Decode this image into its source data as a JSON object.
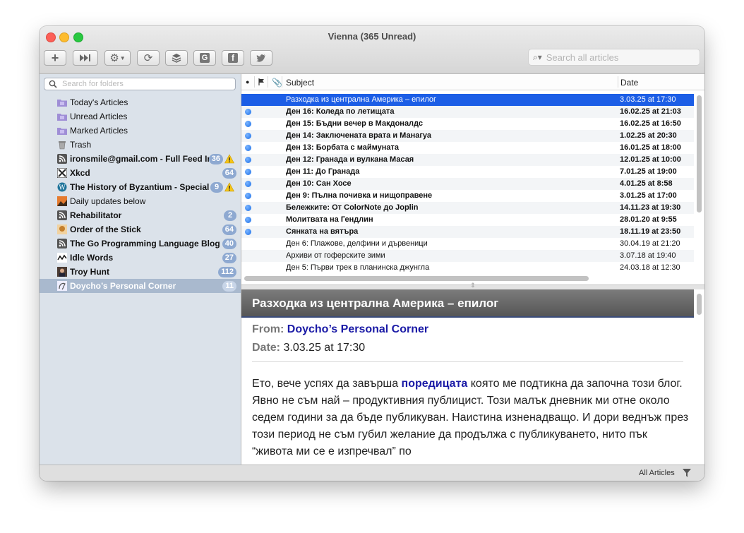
{
  "window": {
    "title": "Vienna (365 Unread)"
  },
  "toolbar": {
    "buttons": [
      {
        "name": "add-subscription",
        "glyph": "+"
      },
      {
        "name": "skip-unread",
        "glyph": "⏭"
      },
      {
        "name": "action-menu",
        "glyph": "⚙▾"
      },
      {
        "name": "refresh",
        "glyph": "⟳"
      },
      {
        "name": "layers",
        "glyph": "≋"
      },
      {
        "name": "google",
        "glyph": "G"
      },
      {
        "name": "facebook",
        "glyph": "f"
      },
      {
        "name": "twitter",
        "glyph": "🐦"
      }
    ],
    "search_placeholder": "Search all articles"
  },
  "sidebar": {
    "search_placeholder": "Search for folders",
    "items": [
      {
        "label": "Today's Articles",
        "icon": "smart-folder",
        "bold": false,
        "count": ""
      },
      {
        "label": "Unread Articles",
        "icon": "smart-folder",
        "bold": false,
        "count": ""
      },
      {
        "label": "Marked Articles",
        "icon": "smart-folder",
        "bold": false,
        "count": ""
      },
      {
        "label": "Trash",
        "icon": "trash",
        "bold": false,
        "count": ""
      },
      {
        "label": "ironsmile@gmail.com - Full Feed In",
        "icon": "rss",
        "bold": true,
        "count": "36",
        "warning": true
      },
      {
        "label": "Xkcd",
        "icon": "xkcd",
        "bold": true,
        "count": "64"
      },
      {
        "label": "The History of Byzantium - Special",
        "icon": "wordpress",
        "bold": true,
        "count": "9",
        "warning": true
      },
      {
        "label": "Daily updates below",
        "icon": "landscape",
        "bold": false,
        "count": ""
      },
      {
        "label": "Rehabilitator",
        "icon": "rss",
        "bold": true,
        "count": "2"
      },
      {
        "label": "Order of the Stick",
        "icon": "oots",
        "bold": true,
        "count": "64"
      },
      {
        "label": "The Go Programming Language Blog",
        "icon": "rss",
        "bold": true,
        "count": "40"
      },
      {
        "label": "Idle Words",
        "icon": "idle",
        "bold": true,
        "count": "27"
      },
      {
        "label": "Troy Hunt",
        "icon": "troy",
        "bold": true,
        "count": "112"
      },
      {
        "label": "Doycho’s Personal Corner",
        "icon": "doycho",
        "bold": true,
        "count": "11",
        "selected": true
      }
    ]
  },
  "list": {
    "columns": {
      "subject": "Subject",
      "date": "Date"
    },
    "rows": [
      {
        "subject": "Разходка из централна Америка – епилог",
        "date": "3.03.25 at 17:30",
        "unread": false,
        "selected": true
      },
      {
        "subject": "Ден 16: Коледа по летищата",
        "date": "16.02.25 at 21:03",
        "unread": true
      },
      {
        "subject": "Ден 15: Бъдни вечер в Макдоналдс",
        "date": "16.02.25 at 16:50",
        "unread": true
      },
      {
        "subject": "Ден 14: Заключената врата и Манагуа",
        "date": "1.02.25 at 20:30",
        "unread": true
      },
      {
        "subject": "Ден 13: Борбата с маймуната",
        "date": "16.01.25 at 18:00",
        "unread": true
      },
      {
        "subject": "Ден 12: Гранада и вулкана Масая",
        "date": "12.01.25 at 10:00",
        "unread": true
      },
      {
        "subject": "Ден 11: До Гранада",
        "date": "7.01.25 at 19:00",
        "unread": true
      },
      {
        "subject": "Ден 10: Сан Хосе",
        "date": "4.01.25 at 8:58",
        "unread": true
      },
      {
        "subject": "Ден 9: Пълна почивка и нищоправене",
        "date": "3.01.25 at 17:00",
        "unread": true
      },
      {
        "subject": "Бележките: От ColorNote до Joplin",
        "date": "14.11.23 at 19:30",
        "unread": true
      },
      {
        "subject": "Молитвата на Гендлин",
        "date": "28.01.20 at 9:55",
        "unread": true
      },
      {
        "subject": "Сянката на вятъра",
        "date": "18.11.19 at 23:50",
        "unread": true
      },
      {
        "subject": "Ден 6: Плажове, делфини и дървеници",
        "date": "30.04.19 at 21:20",
        "unread": false
      },
      {
        "subject": "Архиви от гоферските зими",
        "date": "3.07.18 at 19:40",
        "unread": false
      },
      {
        "subject": "Ден 5: Първи трек в планинска джунгла",
        "date": "24.03.18 at 12:30",
        "unread": false
      }
    ]
  },
  "reader": {
    "title": "Разходка из централна Америка – епилог",
    "from_label": "From:",
    "from_value": "Doycho’s Personal Corner",
    "date_label": "Date:",
    "date_value": "3.03.25 at 17:30",
    "body_prefix": "Ето, вече успях да завърша ",
    "body_link": "поредицата",
    "body_rest": " която ме подтикна да започна този блог. Явно не съм най – продуктивния публицист. Този малък дневник ми отне около седем години за да бъде публикуван. Наистина изненадващо. И дори веднъж през този период не съм губил желание да продължа с публикуването, нито пък “живота ми се е изпречвал” по"
  },
  "status": {
    "filter_label": "All Articles"
  }
}
